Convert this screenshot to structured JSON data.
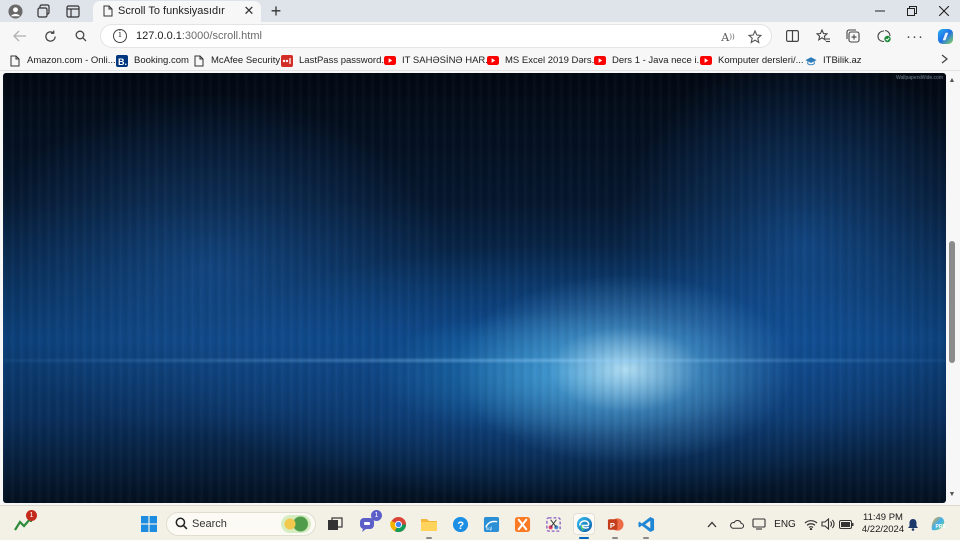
{
  "browser": {
    "tab": {
      "title": "Scroll To funksiyasıdır"
    },
    "address": {
      "host": "127.0.0.1",
      "path": ":3000/scroll.html"
    },
    "bookmarks": [
      {
        "label": "Amazon.com - Onli...",
        "icon": "page-icon"
      },
      {
        "label": "Booking.com",
        "icon": "booking-icon"
      },
      {
        "label": "McAfee Security",
        "icon": "page-icon"
      },
      {
        "label": "LastPass password...",
        "icon": "lastpass-icon"
      },
      {
        "label": "IT SAHƏSİNƏ HAR...",
        "icon": "youtube-icon"
      },
      {
        "label": "MS Excel 2019 Dərs...",
        "icon": "youtube-icon"
      },
      {
        "label": "Ders 1 - Java nece i...",
        "icon": "youtube-icon"
      },
      {
        "label": "Komputer dersleri/...",
        "icon": "youtube-icon"
      },
      {
        "label": "ITBilik.az",
        "icon": "itbilik-icon"
      }
    ],
    "read_aloud_label": "A",
    "scroll_position": 0.55
  },
  "page": {
    "watermark": "WallpapersWide.com"
  },
  "taskbar": {
    "search_label": "Search",
    "weather_badge": "1",
    "teams_badge": "1",
    "language": "ENG",
    "time": "11:49 PM",
    "date": "4/22/2024"
  },
  "colors": {
    "accent": "#0067c0",
    "youtube": "#ff0000",
    "booking": "#003580",
    "lastpass": "#d32d27"
  }
}
